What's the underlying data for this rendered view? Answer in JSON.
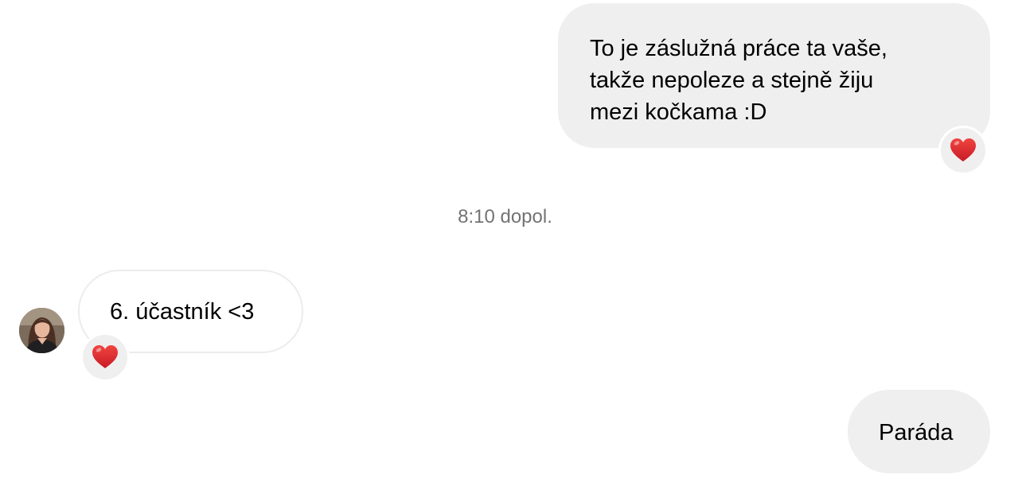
{
  "conversation": {
    "messages": [
      {
        "direction": "outgoing",
        "lines": [
          "To je záslužná práce ta vaše,",
          "takže nepoleze a stejně žiju",
          "mezi kočkama :D"
        ],
        "reaction_icon": "red-heart-icon"
      },
      {
        "direction": "incoming",
        "text": "6. účastník <3",
        "reaction_icon": "red-heart-icon",
        "sender_avatar_icon": "user-avatar"
      },
      {
        "direction": "outgoing",
        "text": "Paráda"
      }
    ],
    "timestamp": "8:10 dopol."
  },
  "colors": {
    "outgoing_bubble": "#efefef",
    "incoming_bubble_border": "#ececec",
    "timestamp_text": "#737373",
    "heart": "#e3262e"
  }
}
